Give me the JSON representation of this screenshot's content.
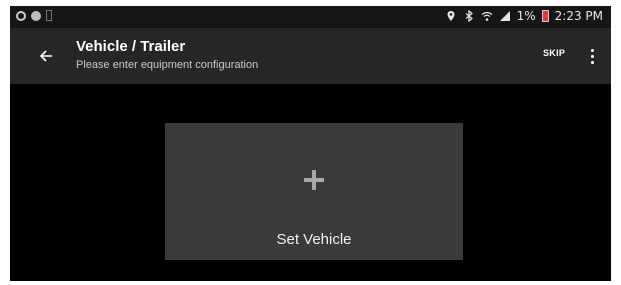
{
  "status_bar": {
    "battery_text": "1%",
    "time": "2:23 PM",
    "left_icons": [
      "app-icon",
      "notification-icon",
      "sim-icon"
    ],
    "right_icons": [
      "location-icon",
      "bluetooth-icon",
      "wifi-icon",
      "signal-icon",
      "battery-icon"
    ],
    "battery_color": "#e53935"
  },
  "toolbar": {
    "back_icon": "arrow-left-icon",
    "title": "Vehicle / Trailer",
    "subtitle": "Please enter equipment configuration",
    "skip_label": "SKIP",
    "more_icon": "more-vert-icon",
    "background": "#262626"
  },
  "content": {
    "card_icon": "plus-icon",
    "card_label": "Set Vehicle",
    "card_background": "#3a3a3a"
  }
}
